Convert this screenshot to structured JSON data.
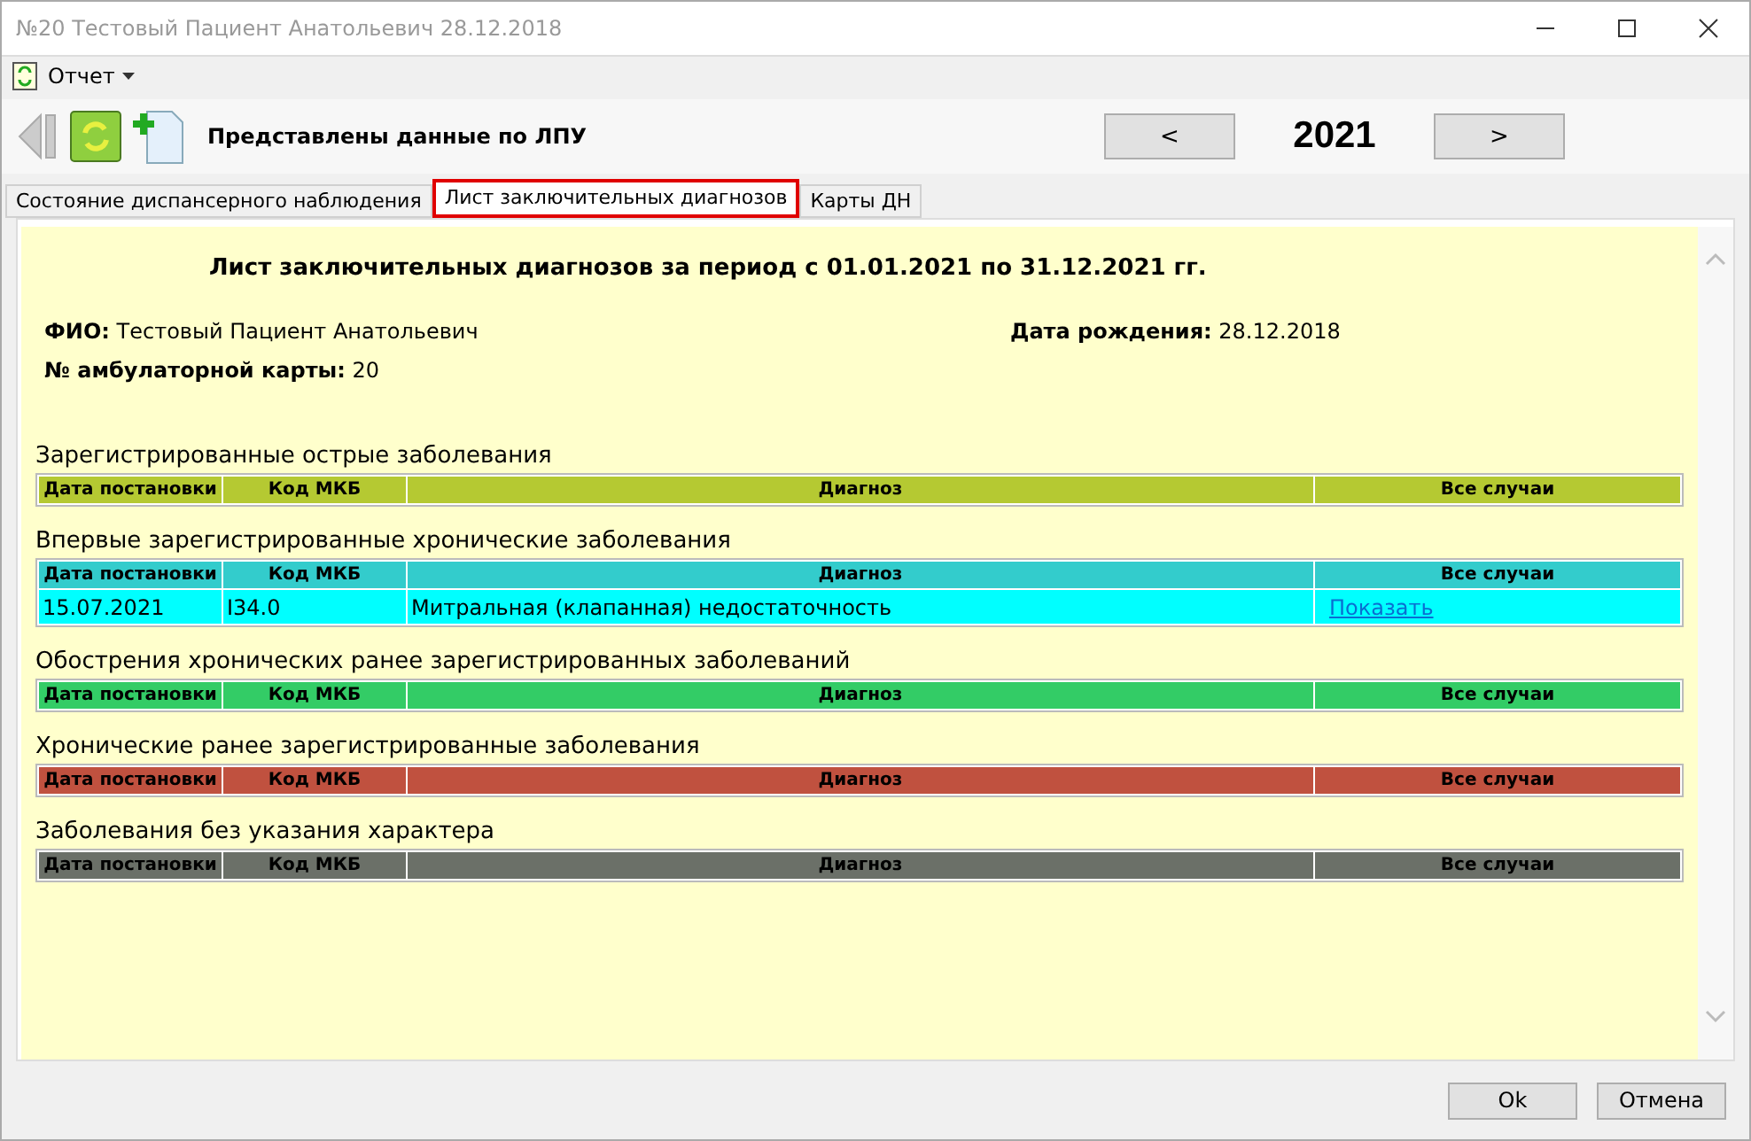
{
  "window": {
    "title": "№20 Тестовый Пациент Анатольевич 28.12.2018"
  },
  "menu": [
    {
      "label": "Отчет"
    }
  ],
  "toolbar": {
    "caption": "Представлены данные по ЛПУ",
    "prev": "<",
    "year": "2021",
    "next": ">"
  },
  "tabs": [
    {
      "label": "Состояние диспансерного наблюдения",
      "selected": false
    },
    {
      "label": "Лист заключительных диагнозов",
      "selected": true
    },
    {
      "label": "Карты ДН",
      "selected": false
    }
  ],
  "report": {
    "title": "Лист заключительных диагнозов за период с 01.01.2021 по 31.12.2021 гг.",
    "fio_label": "ФИО:",
    "fio": "Тестовый Пациент Анатольевич",
    "birth_label": "Дата рождения:",
    "birth": "28.12.2018",
    "card_label": "№ амбулаторной карты:",
    "card": "20"
  },
  "sections": [
    {
      "title": "Зарегистрированные острые заболевания",
      "color": "#b5c932",
      "columns": [
        "Дата постановки",
        "Код МКБ",
        "Диагноз",
        "Все случаи"
      ]
    },
    {
      "title": "Впервые зарегистрированные хронические заболевания",
      "color": "#33cccc",
      "columns": [
        "Дата постановки",
        "Код МКБ",
        "Диагноз",
        "Все случаи"
      ],
      "rows": [
        {
          "date": "15.07.2021",
          "code": "I34.0",
          "diagnosis": "Митральная (клапанная) недостаточность",
          "link": "Показать"
        }
      ]
    },
    {
      "title": "Обострения хронических ранее зарегистрированных заболеваний",
      "color": "#33cc66",
      "columns": [
        "Дата постановки",
        "Код МКБ",
        "Диагноз",
        "Все случаи"
      ]
    },
    {
      "title": "Хронические ранее зарегистрированные заболевания",
      "color": "#c0513f",
      "columns": [
        "Дата постановки",
        "Код МКБ",
        "Диагноз",
        "Все случаи"
      ]
    },
    {
      "title": "Заболевания без указания характера",
      "color": "#6b7068",
      "columns": [
        "Дата постановки",
        "Код МКБ",
        "Диагноз",
        "Все случаи"
      ]
    }
  ],
  "buttons": [
    "Ok",
    "Отмена"
  ]
}
